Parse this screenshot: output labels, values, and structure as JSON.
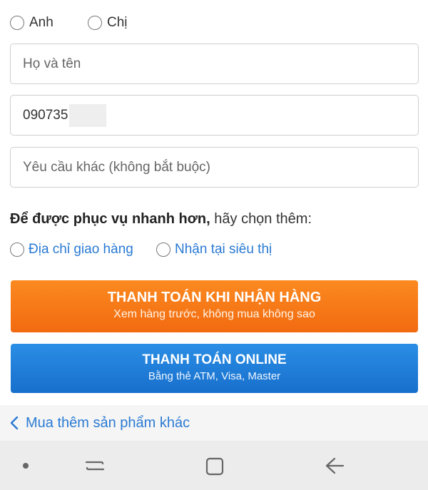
{
  "gender": {
    "option1": "Anh",
    "option2": "Chị"
  },
  "form": {
    "name_placeholder": "Họ và tên",
    "phone_value": "090735",
    "note_placeholder": "Yêu cầu khác (không bắt buộc)"
  },
  "delivery": {
    "prompt_bold": "Để được phục vụ nhanh hơn,",
    "prompt_rest": " hãy chọn thêm:",
    "option_address": "Địa chỉ giao hàng",
    "option_store": "Nhận tại siêu thị"
  },
  "buttons": {
    "cod_title": "THANH TOÁN KHI NHẬN HÀNG",
    "cod_subtitle": "Xem hàng trước, không mua không sao",
    "online_title": "THANH TOÁN ONLINE",
    "online_subtitle": "Bằng thẻ ATM, Visa, Master"
  },
  "more_link": "Mua thêm sản phẩm khác",
  "colors": {
    "cod_orange": "#f57c1a",
    "online_blue": "#2280d8",
    "link_blue": "#2a7ad3"
  },
  "navbar": {
    "icons": [
      "dot-icon",
      "recent-apps-icon",
      "home-icon",
      "back-icon"
    ]
  }
}
